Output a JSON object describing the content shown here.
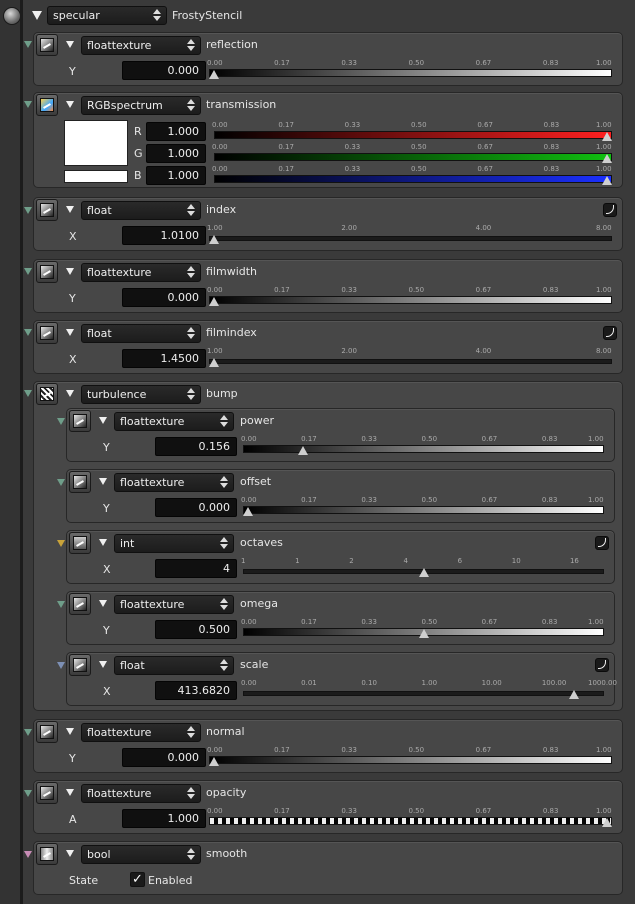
{
  "header": {
    "type": "specular",
    "name": "FrostyStencil",
    "icon": "gear-icon"
  },
  "ticks": {
    "unit": [
      "0.00",
      "0.17",
      "0.33",
      "0.50",
      "0.67",
      "0.83",
      "1.00"
    ],
    "index": [
      "1.00",
      "2.00",
      "4.00",
      "8.00"
    ],
    "octaves": [
      "1",
      "1",
      "2",
      "4",
      "6",
      "10",
      "16"
    ],
    "scale": [
      "0.00",
      "0.01",
      "0.10",
      "1.00",
      "10.00",
      "100.00",
      "1000.00"
    ]
  },
  "reflection": {
    "type": "floattexture",
    "label": "reflection",
    "axis": "Y",
    "value": "0.000",
    "level": 0
  },
  "transmission": {
    "type": "RGBspectrum",
    "label": "transmission",
    "color": "#ffffff",
    "r": {
      "axis": "R",
      "value": "1.000",
      "level": 1
    },
    "g": {
      "axis": "G",
      "value": "1.000",
      "level": 1
    },
    "b": {
      "axis": "B",
      "value": "1.000",
      "level": 1
    }
  },
  "index": {
    "type": "float",
    "label": "index",
    "axis": "X",
    "value": "1.0100",
    "level": 0
  },
  "filmwidth": {
    "type": "floattexture",
    "label": "filmwidth",
    "axis": "Y",
    "value": "0.000",
    "level": 0
  },
  "filmindex": {
    "type": "float",
    "label": "filmindex",
    "axis": "X",
    "value": "1.4500",
    "level": 0
  },
  "bump": {
    "type": "turbulence",
    "label": "bump",
    "power": {
      "type": "floattexture",
      "label": "power",
      "axis": "Y",
      "value": "0.156",
      "level": 0.156
    },
    "offset": {
      "type": "floattexture",
      "label": "offset",
      "axis": "Y",
      "value": "0.000",
      "level": 0
    },
    "octaves": {
      "type": "int",
      "label": "octaves",
      "axis": "X",
      "value": "4",
      "level": 0.5
    },
    "omega": {
      "type": "floattexture",
      "label": "omega",
      "axis": "Y",
      "value": "0.500",
      "level": 0.5
    },
    "scale": {
      "type": "float",
      "label": "scale",
      "axis": "X",
      "value": "413.6820",
      "level": 0.93
    }
  },
  "normal": {
    "type": "floattexture",
    "label": "normal",
    "axis": "Y",
    "value": "0.000",
    "level": 0
  },
  "opacity": {
    "type": "floattexture",
    "label": "opacity",
    "axis": "A",
    "value": "1.000",
    "level": 1
  },
  "smooth": {
    "type": "bool",
    "label": "smooth",
    "axis": "State",
    "value": "Enabled",
    "checked": true
  }
}
